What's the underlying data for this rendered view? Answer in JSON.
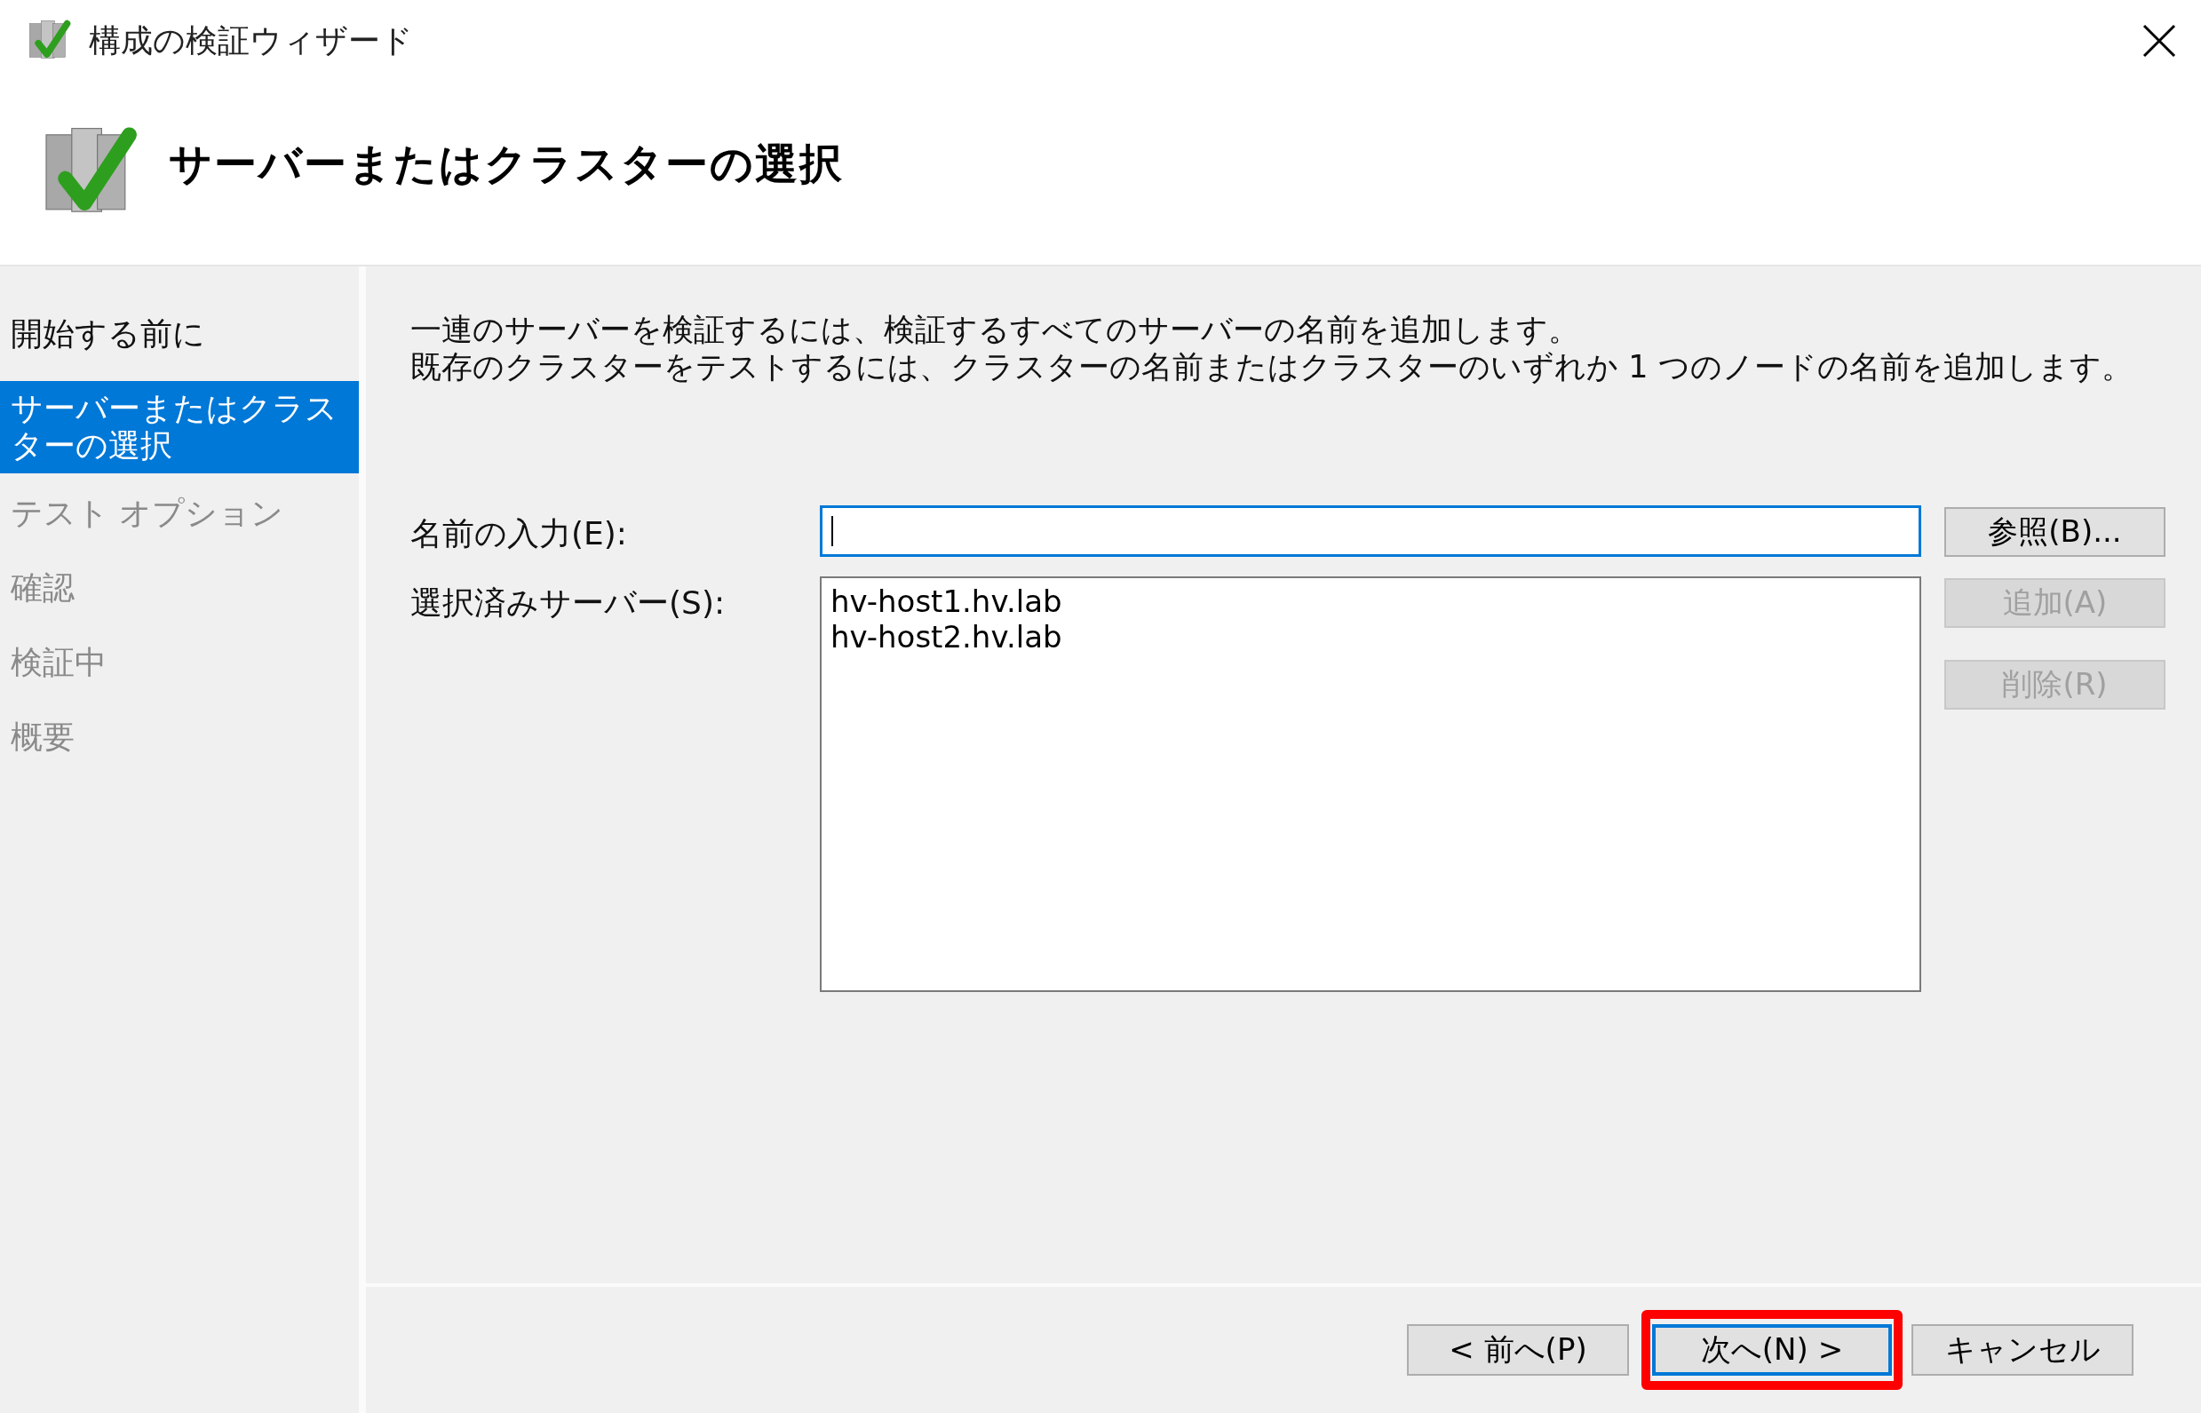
{
  "window": {
    "title": "構成の検証ウィザード"
  },
  "header": {
    "title": "サーバーまたはクラスターの選択"
  },
  "sidebar": {
    "items": [
      {
        "label": "開始する前に",
        "selected": false,
        "disabled": false
      },
      {
        "label": "サーバーまたはクラスターの選択",
        "selected": true,
        "disabled": false
      },
      {
        "label": "テスト オプション",
        "selected": false,
        "disabled": true
      },
      {
        "label": "確認",
        "selected": false,
        "disabled": true
      },
      {
        "label": "検証中",
        "selected": false,
        "disabled": true
      },
      {
        "label": "概要",
        "selected": false,
        "disabled": true
      }
    ]
  },
  "description": [
    "一連のサーバーを検証するには、検証するすべてのサーバーの名前を追加します。",
    "既存のクラスターをテストするには、クラスターの名前またはクラスターのいずれか 1 つのノードの名前を追加します。"
  ],
  "name_field": {
    "label": "名前の入力(E):",
    "focused": true
  },
  "servers": {
    "label": "選択済みサーバー(S):",
    "items": [
      "hv-host1.hv.lab",
      "hv-host2.hv.lab"
    ]
  },
  "side_buttons": [
    {
      "label": "参照(B)...",
      "disabled": false
    },
    {
      "label": "追加(A)",
      "disabled": true
    },
    {
      "label": "削除(R)",
      "disabled": true
    }
  ],
  "footer_buttons": [
    {
      "label": "< 前へ(P)",
      "default": false,
      "highlighted": false
    },
    {
      "label": "次へ(N) >",
      "default": true,
      "highlighted": true
    },
    {
      "label": "キャンセル",
      "default": false,
      "highlighted": false
    }
  ]
}
